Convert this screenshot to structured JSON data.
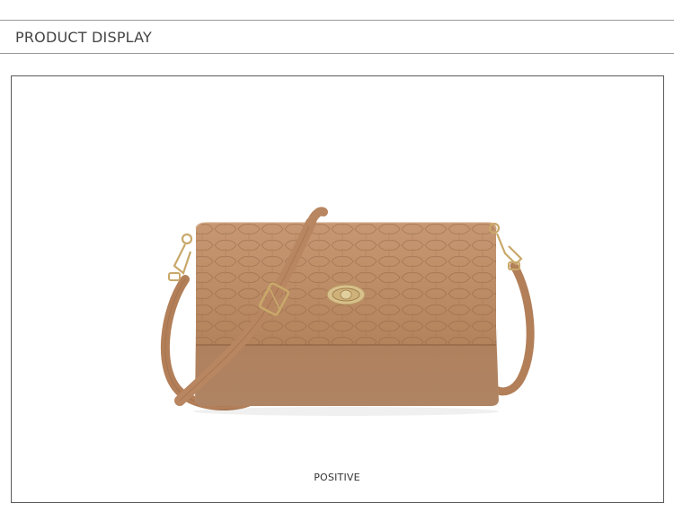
{
  "header": {
    "title": "PRODUCT DISPLAY"
  },
  "image": {
    "subject": "handbag-photo",
    "colors": {
      "leather": "#b98b66",
      "leather_dark": "#a5744f",
      "leather_light": "#c99d78",
      "hardware": "#c9a86a"
    }
  },
  "caption": {
    "text": "POSITIVE"
  }
}
